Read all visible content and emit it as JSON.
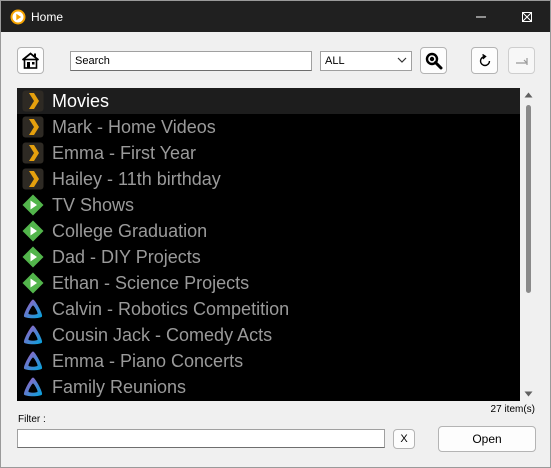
{
  "window": {
    "title": "Home",
    "app_icon": "orange-play-circle-icon",
    "controls": [
      "minimize-icon",
      "maximize-icon",
      "close-icon"
    ]
  },
  "toolbar": {
    "home_icon": "home-icon",
    "search_placeholder": "Search",
    "search_value": "",
    "filter_select_value": "ALL",
    "search_button_icon": "magnifier-icon",
    "refresh_icon": "refresh-icon",
    "exit_icon": "exit-arrow-icon"
  },
  "list": {
    "items": [
      {
        "label": "Movies",
        "icon": "plex-chevron-icon",
        "selected": true
      },
      {
        "label": "Mark - Home Videos",
        "icon": "plex-chevron-icon"
      },
      {
        "label": "Emma - First Year",
        "icon": "plex-chevron-icon"
      },
      {
        "label": "Hailey - 11th birthday",
        "icon": "plex-chevron-icon"
      },
      {
        "label": "TV Shows",
        "icon": "emby-play-icon"
      },
      {
        "label": "College Graduation",
        "icon": "emby-play-icon"
      },
      {
        "label": "Dad - DIY Projects",
        "icon": "emby-play-icon"
      },
      {
        "label": "Ethan - Science Projects",
        "icon": "emby-play-icon"
      },
      {
        "label": "Calvin - Robotics Competition",
        "icon": "jellyfin-triangle-icon"
      },
      {
        "label": "Cousin Jack - Comedy Acts",
        "icon": "jellyfin-triangle-icon"
      },
      {
        "label": "Emma - Piano Concerts",
        "icon": "jellyfin-triangle-icon"
      },
      {
        "label": "Family Reunions",
        "icon": "jellyfin-triangle-icon"
      }
    ],
    "item_count": "27 item(s)"
  },
  "filter": {
    "label": "Filter :",
    "value": "",
    "clear_label": "X"
  },
  "open_label": "Open"
}
